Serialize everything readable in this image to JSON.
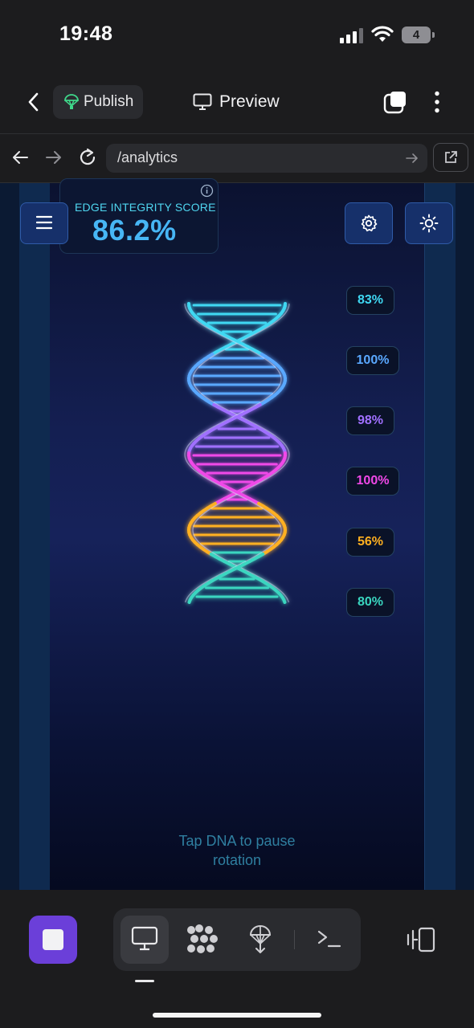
{
  "status_bar": {
    "time": "19:48",
    "battery": "4"
  },
  "topbar": {
    "publish_label": "Publish",
    "preview_label": "Preview"
  },
  "browser": {
    "url": "/analytics"
  },
  "score": {
    "label": "EDGE INTEGRITY SCORE",
    "value": "86.2%"
  },
  "segments": [
    {
      "label": "83%",
      "color": "#3fd8f2"
    },
    {
      "label": "100%",
      "color": "#5aa8ff"
    },
    {
      "label": "98%",
      "color": "#a070ff"
    },
    {
      "label": "100%",
      "color": "#f048e8"
    },
    {
      "label": "56%",
      "color": "#ffb020"
    },
    {
      "label": "80%",
      "color": "#3ad6c0"
    }
  ],
  "hint": "Tap DNA to pause rotation",
  "icons": {
    "back": "chevron-left-icon",
    "publish": "parachute-icon",
    "preview": "monitor-icon",
    "tabs": "tabs-icon",
    "more": "kebab-icon",
    "nav_back": "arrow-left-icon",
    "nav_forward": "arrow-right-icon",
    "reload": "reload-icon",
    "go": "arrow-right-icon",
    "external": "external-link-icon",
    "menu": "hamburger-icon",
    "settings": "gear-icon",
    "theme": "sun-icon",
    "stop": "stop-icon",
    "device": "monitor-icon",
    "components": "grid-dots-icon",
    "deploy": "parachute-icon",
    "terminal": "terminal-icon",
    "panel": "side-panel-icon"
  }
}
